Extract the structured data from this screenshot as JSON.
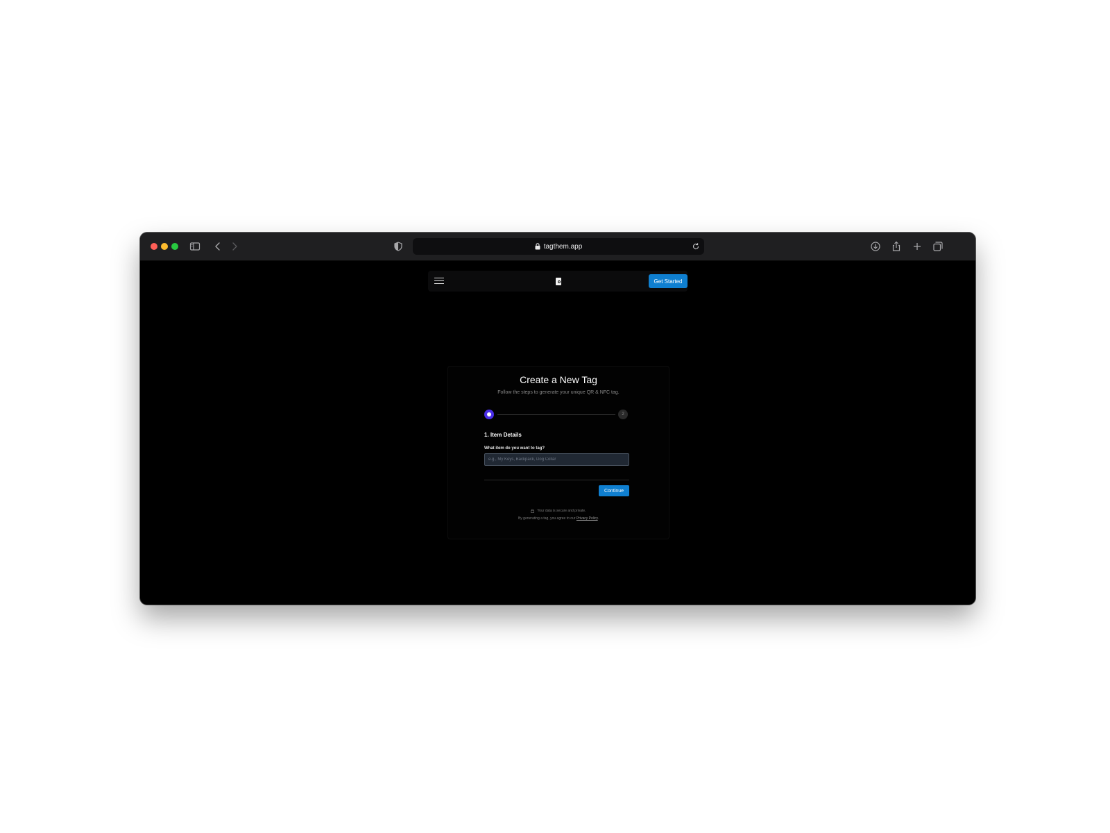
{
  "browser": {
    "url": "tagthem.app",
    "icons": [
      "sidebar-icon",
      "back-icon",
      "forward-icon",
      "shield-icon",
      "lock-icon",
      "reload-icon",
      "download-icon",
      "share-icon",
      "new-tab-icon",
      "tab-overview-icon"
    ]
  },
  "nav": {
    "get_started": "Get Started"
  },
  "form": {
    "title": "Create a New Tag",
    "subtitle": "Follow the steps to generate your unique QR & NFC tag.",
    "step2_label": "2",
    "section_title": "1. Item Details",
    "field_label": "What item do you want to tag?",
    "field_placeholder": "e.g., My Keys, Backpack, Dog Collar",
    "field_value": "",
    "continue_label": "Continue",
    "secure_note": "Your data is secure and private.",
    "policy_text": "By generating a tag, you agree to our ",
    "policy_link": "Privacy Policy",
    "policy_end": "."
  },
  "colors": {
    "accent": "#0f7fd0",
    "step_active": "#4a2ee8",
    "background": "#000000"
  }
}
